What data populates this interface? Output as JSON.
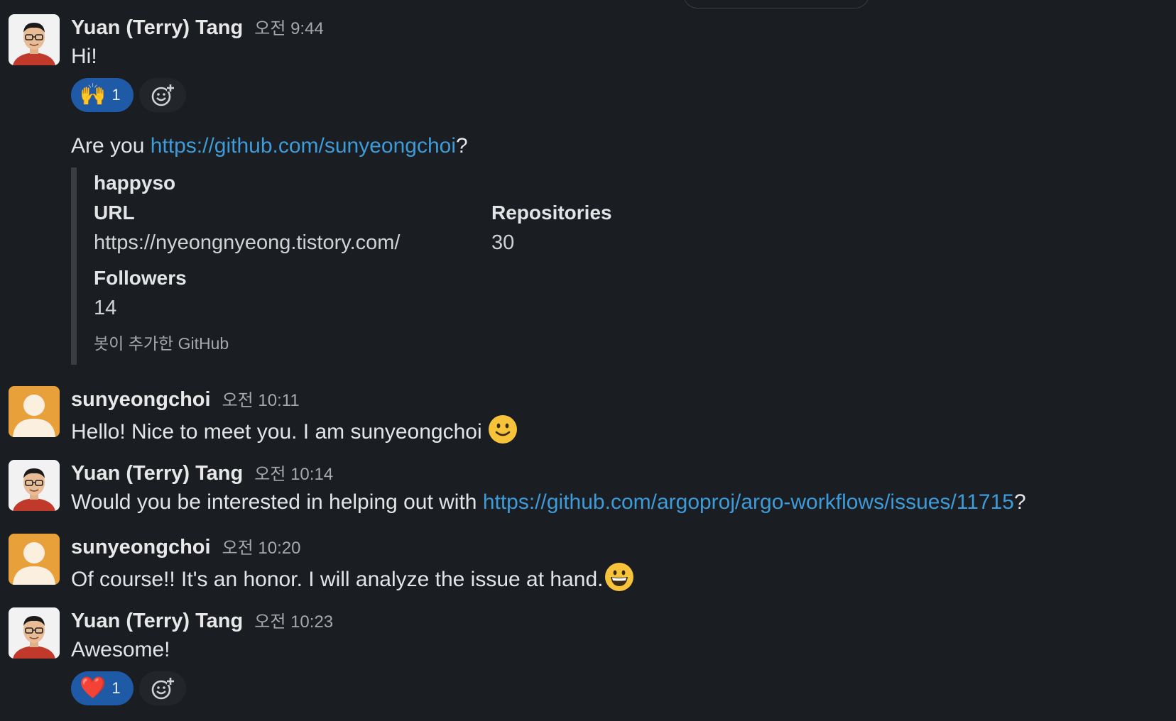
{
  "messages": [
    {
      "author": "Yuan (Terry) Tang",
      "time": "오전 9:44",
      "text": "Hi!",
      "reaction": {
        "emoji": "🙌",
        "count": "1"
      }
    },
    {
      "text_prefix": "Are you ",
      "link": "https://github.com/sunyeongchoi",
      "text_suffix": "?",
      "attachment": {
        "title": "happyso",
        "fields": [
          {
            "label": "URL",
            "value": "https://nyeongnyeong.tistory.com/"
          },
          {
            "label": "Repositories",
            "value": "30"
          },
          {
            "label": "Followers",
            "value": "14"
          }
        ],
        "footer": "봇이 추가한 GitHub"
      }
    },
    {
      "author": "sunyeongchoi",
      "time": "오전 10:11",
      "text": "Hello! Nice to meet you. I am sunyeongchoi",
      "emoji": "slightly-smiling-face"
    },
    {
      "author": "Yuan (Terry) Tang",
      "time": "오전 10:14",
      "text_prefix": "Would you be interested in helping out with ",
      "link": "https://github.com/argoproj/argo-workflows/issues/11715",
      "text_suffix": "?"
    },
    {
      "author": "sunyeongchoi",
      "time": "오전 10:20",
      "text": "Of course!! It's an honor. I will analyze the issue at hand.",
      "emoji": "grinning-face"
    },
    {
      "author": "Yuan (Terry) Tang",
      "time": "오전 10:23",
      "text": "Awesome!",
      "reaction": {
        "emoji": "❤️",
        "count": "1"
      }
    }
  ],
  "icons": {
    "add_reaction": "add-reaction-icon"
  },
  "colors": {
    "background": "#1a1d21",
    "link": "#3d9bd9",
    "reaction_active": "#1f5aa6",
    "avatar_default": "#e8a13a"
  }
}
